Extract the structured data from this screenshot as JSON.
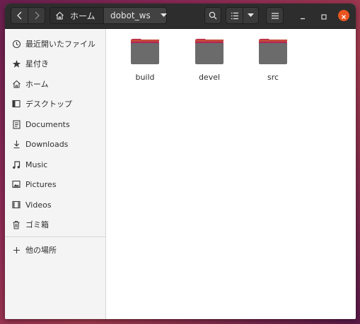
{
  "header": {
    "home_label": "ホーム",
    "current_folder": "dobot_ws"
  },
  "sidebar": {
    "items": [
      {
        "label": "最近開いたファイル",
        "icon": "clock-icon"
      },
      {
        "label": "星付き",
        "icon": "star-icon"
      },
      {
        "label": "ホーム",
        "icon": "home-icon"
      },
      {
        "label": "デスクトップ",
        "icon": "desktop-icon"
      },
      {
        "label": "Documents",
        "icon": "document-icon"
      },
      {
        "label": "Downloads",
        "icon": "download-icon"
      },
      {
        "label": "Music",
        "icon": "music-icon"
      },
      {
        "label": "Pictures",
        "icon": "picture-icon"
      },
      {
        "label": "Videos",
        "icon": "video-icon"
      },
      {
        "label": "ゴミ箱",
        "icon": "trash-icon"
      }
    ],
    "other_locations": {
      "label": "他の場所",
      "icon": "plus-icon"
    }
  },
  "files": [
    {
      "name": "build",
      "icon": "folder-icon"
    },
    {
      "name": "devel",
      "icon": "folder-icon"
    },
    {
      "name": "src",
      "icon": "folder-icon"
    }
  ],
  "colors": {
    "accent": "#e95420",
    "folder_body": "#6b6b6b",
    "folder_tab": "#b32457",
    "headerbar": "#2d2d2d"
  }
}
